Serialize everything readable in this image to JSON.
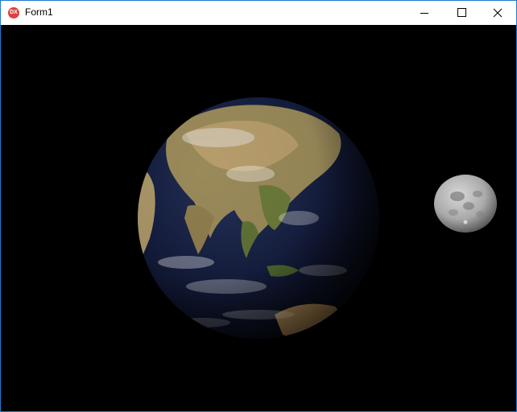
{
  "window": {
    "title": "Form1",
    "app_icon": "devexpress-dx-icon",
    "controls": [
      "minimize-icon",
      "maximize-icon",
      "close-icon"
    ]
  },
  "scene": {
    "objects": [
      {
        "name": "earth",
        "icon": "earth-globe"
      },
      {
        "name": "moon",
        "icon": "moon-sphere"
      }
    ],
    "background_color": "#000000"
  },
  "colors": {
    "title_bar": "#ffffff",
    "window_border": "#1e7ad2",
    "app_icon": "#e0403f"
  }
}
